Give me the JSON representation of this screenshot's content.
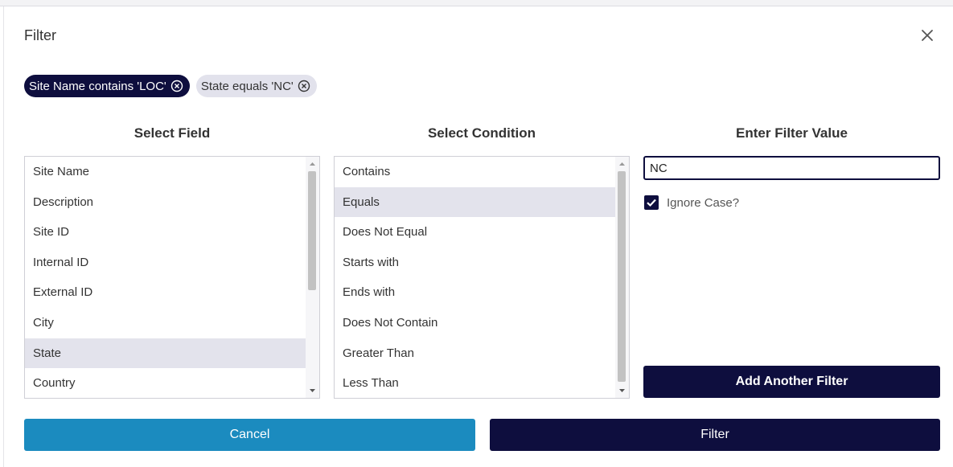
{
  "dialog": {
    "title": "Filter"
  },
  "chips": [
    {
      "label": "Site Name contains 'LOC'",
      "active": true
    },
    {
      "label": "State equals 'NC'",
      "active": false
    }
  ],
  "columns": {
    "field_heading": "Select Field",
    "condition_heading": "Select Condition",
    "value_heading": "Enter Filter Value"
  },
  "fields": {
    "items": [
      "Site Name",
      "Description",
      "Site ID",
      "Internal ID",
      "External ID",
      "City",
      "State",
      "Country"
    ],
    "selected": "State"
  },
  "conditions": {
    "items": [
      "Contains",
      "Equals",
      "Does Not Equal",
      "Starts with",
      "Ends with",
      "Does Not Contain",
      "Greater Than",
      "Less Than"
    ],
    "selected": "Equals"
  },
  "filter_value": {
    "value": "NC",
    "placeholder": ""
  },
  "ignore_case": {
    "label": "Ignore Case?",
    "checked": true
  },
  "buttons": {
    "add_another": "Add Another Filter",
    "cancel": "Cancel",
    "filter": "Filter"
  },
  "colors": {
    "primary": "#0e0e3e",
    "secondary": "#1b8bbf",
    "selection": "#e3e3ec"
  }
}
